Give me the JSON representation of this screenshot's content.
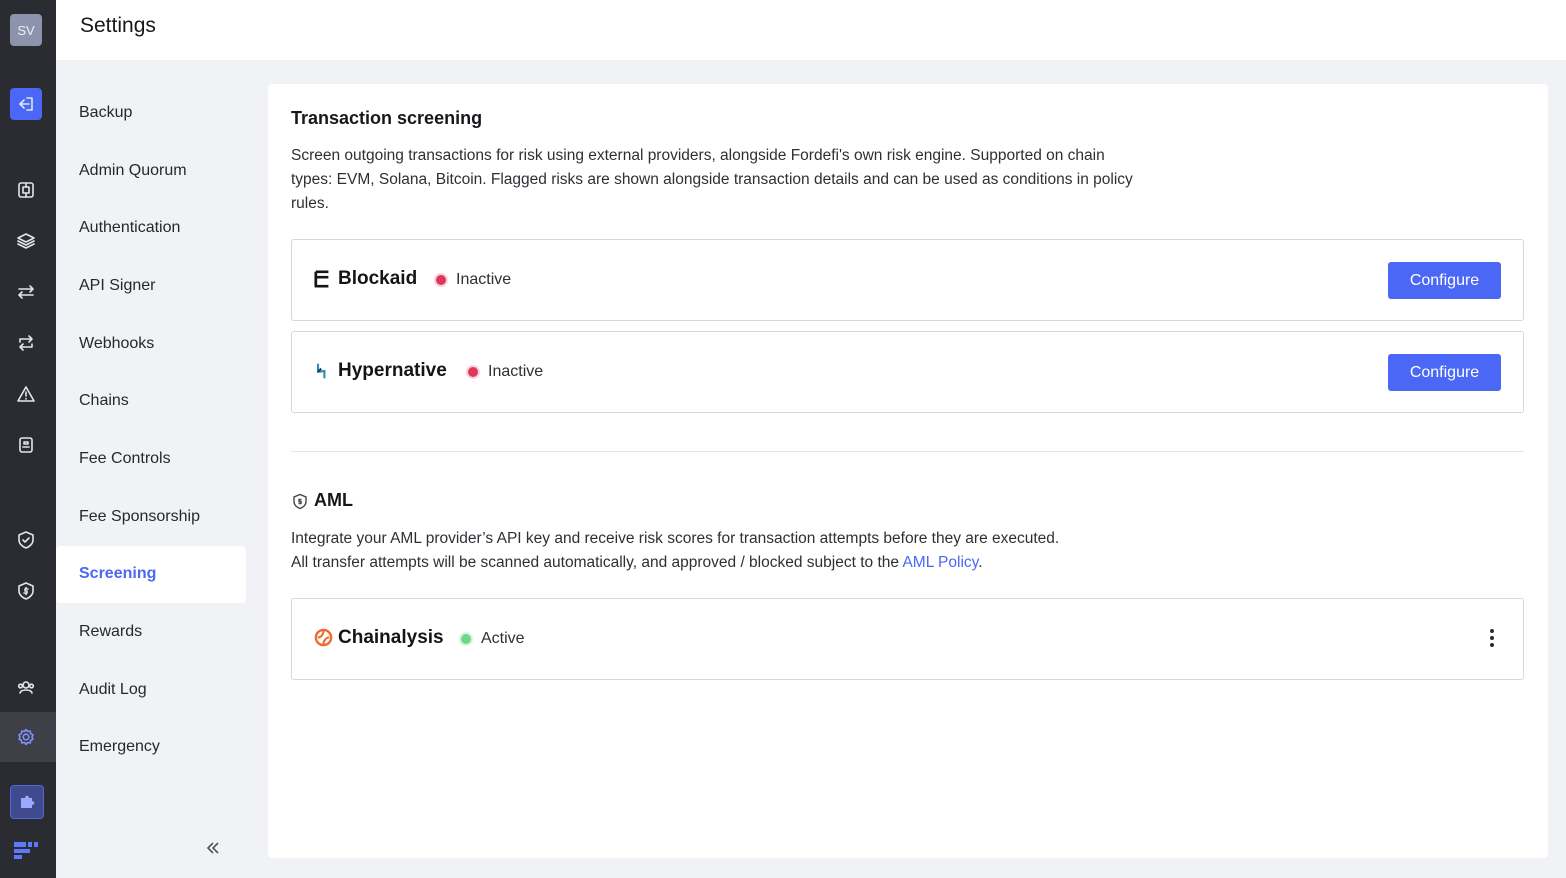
{
  "app": {
    "title": "Settings",
    "avatar_initials": "SV",
    "accent_color": "#4a67f5"
  },
  "rail": {
    "icons": [
      "logout-icon",
      "vault-icon",
      "layers-icon",
      "transfer-icon",
      "repeat-icon",
      "alert-icon",
      "report-icon",
      "shield-check-icon",
      "shield-dollar-icon",
      "users-icon",
      "gear-icon",
      "puzzle-icon",
      "brand-logo-icon"
    ]
  },
  "nav": {
    "items": [
      {
        "label": "Backup"
      },
      {
        "label": "Admin Quorum"
      },
      {
        "label": "Authentication"
      },
      {
        "label": "API Signer"
      },
      {
        "label": "Webhooks"
      },
      {
        "label": "Chains"
      },
      {
        "label": "Fee Controls"
      },
      {
        "label": "Fee Sponsorship"
      },
      {
        "label": "Screening",
        "active": true
      },
      {
        "label": "Rewards"
      },
      {
        "label": "Audit Log"
      },
      {
        "label": "Emergency"
      }
    ],
    "collapse_icon": "double-chevron-left-icon"
  },
  "screening": {
    "title": "Transaction screening",
    "description": "Screen outgoing transactions for risk using external providers, alongside Fordefi's own risk engine. Supported on chain types: EVM, Solana, Bitcoin. Flagged risks are shown alongside transaction details and can be used as conditions in policy rules.",
    "providers": [
      {
        "name": "Blockaid",
        "status": "Inactive",
        "button": "Configure"
      },
      {
        "name": "Hypernative",
        "status": "Inactive",
        "button": "Configure"
      }
    ]
  },
  "aml": {
    "title": "AML",
    "description_line1": "Integrate your AML provider’s API key and receive risk scores for transaction attempts before they are executed.",
    "description_line2_prefix": "All transfer attempts will be scanned automatically, and approved / blocked subject to the ",
    "link_text": "AML Policy",
    "description_line2_suffix": ".",
    "provider": {
      "name": "Chainalysis",
      "status": "Active"
    }
  },
  "colors": {
    "inactive": "#e0365c",
    "active": "#6fd98a"
  }
}
